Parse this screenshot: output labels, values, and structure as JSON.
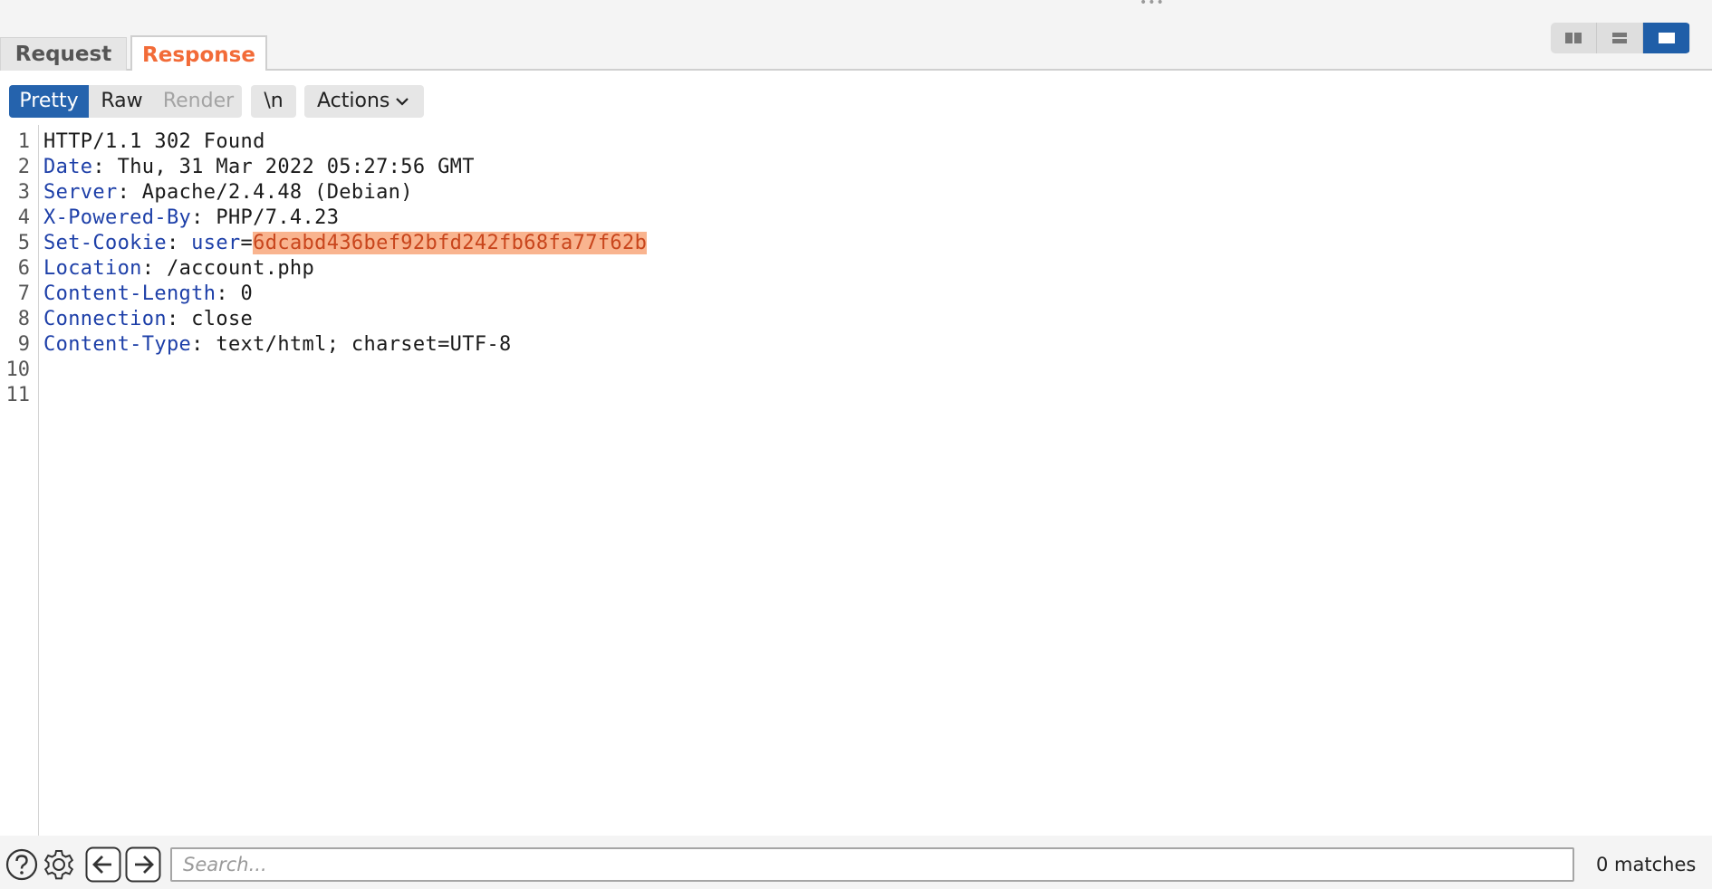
{
  "tabs": [
    {
      "label": "Request",
      "active": false
    },
    {
      "label": "Response",
      "active": true
    }
  ],
  "layout_toggles": [
    {
      "icon": "split-columns-icon",
      "active": false
    },
    {
      "icon": "split-rows-icon",
      "active": false
    },
    {
      "icon": "single-pane-icon",
      "active": true
    }
  ],
  "toolbar": {
    "pretty_label": "Pretty",
    "raw_label": "Raw",
    "render_label": "Render",
    "newline_label": "\\n",
    "actions_label": "Actions"
  },
  "editor": {
    "line_numbers": [
      "1",
      "2",
      "3",
      "4",
      "5",
      "6",
      "7",
      "8",
      "9",
      "10",
      "11"
    ],
    "lines": [
      {
        "name": "",
        "sep": "",
        "value": "HTTP/1.1 302 Found"
      },
      {
        "name": "Date",
        "sep": ": ",
        "value": "Thu, 31 Mar 2022 05:27:56 GMT"
      },
      {
        "name": "Server",
        "sep": ": ",
        "value": "Apache/2.4.48 (Debian)"
      },
      {
        "name": "X-Powered-By",
        "sep": ": ",
        "value": "PHP/7.4.23"
      },
      {
        "name": "Set-Cookie",
        "sep": ": ",
        "value": ""
      },
      {
        "name": "Location",
        "sep": ": ",
        "value": "/account.php"
      },
      {
        "name": "Content-Length",
        "sep": ": ",
        "value": "0"
      },
      {
        "name": "Connection",
        "sep": ": ",
        "value": "close"
      },
      {
        "name": "Content-Type",
        "sep": ": ",
        "value": "text/html; charset=UTF-8"
      },
      {
        "name": "",
        "sep": "",
        "value": ""
      },
      {
        "name": "",
        "sep": "",
        "value": ""
      }
    ],
    "cookie": {
      "name": "user",
      "eq": "=",
      "value": "6dcabd436bef92bfd242fb68fa77f62b"
    },
    "highlight_color": "#f9b48f"
  },
  "search": {
    "placeholder": "Search...",
    "value": "",
    "matches_label": "0 matches"
  },
  "colors": {
    "accent": "#2563ad",
    "active_tab": "#f26b38",
    "header_name": "#1d3fa8"
  }
}
